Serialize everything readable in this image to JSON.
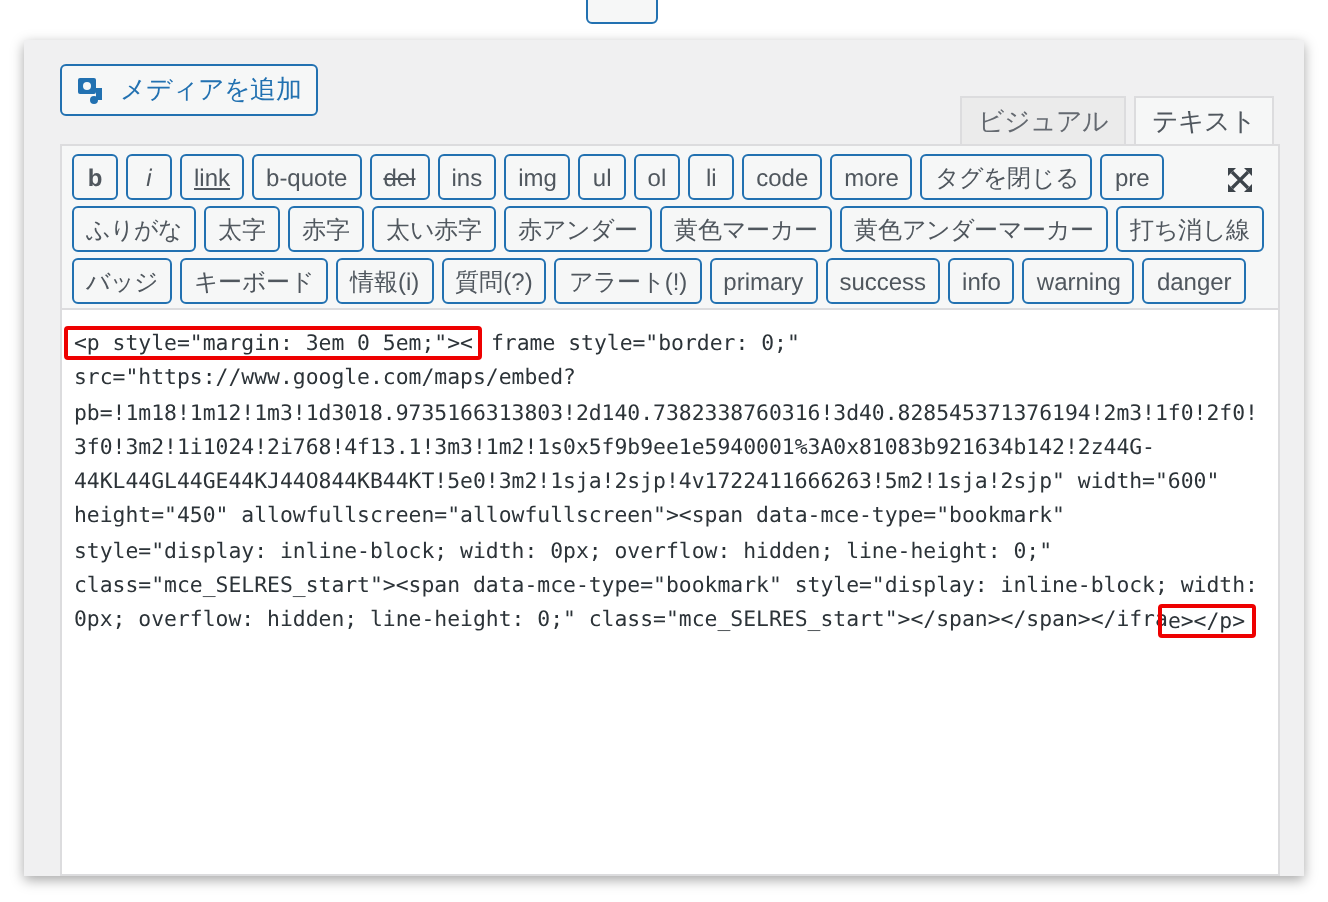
{
  "media_button": {
    "label": "メディアを追加"
  },
  "tabs": [
    {
      "label": "ビジュアル",
      "selected": false
    },
    {
      "label": "テキスト",
      "selected": true
    }
  ],
  "toolbar_rows": [
    [
      {
        "label": "b",
        "kind": "bold"
      },
      {
        "label": "i",
        "kind": "italic"
      },
      {
        "label": "link",
        "kind": "underline"
      },
      {
        "label": "b-quote",
        "kind": "plain"
      },
      {
        "label": "del",
        "kind": "strike"
      },
      {
        "label": "ins",
        "kind": "plain"
      },
      {
        "label": "img",
        "kind": "plain"
      },
      {
        "label": "ul",
        "kind": "plain"
      },
      {
        "label": "ol",
        "kind": "plain"
      },
      {
        "label": "li",
        "kind": "plain"
      },
      {
        "label": "code",
        "kind": "plain"
      },
      {
        "label": "more",
        "kind": "plain"
      },
      {
        "label": "タグを閉じる",
        "kind": "plain"
      },
      {
        "label": "pre",
        "kind": "plain"
      }
    ],
    [
      {
        "label": "ふりがな",
        "kind": "plain"
      },
      {
        "label": "太字",
        "kind": "plain"
      },
      {
        "label": "赤字",
        "kind": "plain"
      },
      {
        "label": "太い赤字",
        "kind": "plain"
      },
      {
        "label": "赤アンダー",
        "kind": "plain"
      },
      {
        "label": "黄色マーカー",
        "kind": "plain"
      },
      {
        "label": "黄色アンダーマーカー",
        "kind": "plain"
      },
      {
        "label": "打ち消し線",
        "kind": "plain"
      }
    ],
    [
      {
        "label": "バッジ",
        "kind": "plain"
      },
      {
        "label": "キーボード",
        "kind": "plain"
      },
      {
        "label": "情報(i)",
        "kind": "plain"
      },
      {
        "label": "質問(?)",
        "kind": "plain"
      },
      {
        "label": "アラート(!)",
        "kind": "plain"
      },
      {
        "label": "primary",
        "kind": "plain"
      },
      {
        "label": "success",
        "kind": "plain"
      },
      {
        "label": "info",
        "kind": "plain"
      },
      {
        "label": "warning",
        "kind": "plain"
      },
      {
        "label": "danger",
        "kind": "plain"
      }
    ]
  ],
  "code_lines": [
    {
      "segments": [
        {
          "text": "<p style=\"margin: 3em 0 5em;\"><",
          "highlighted": true
        },
        {
          "text": "frame style=\"border: 0;\"",
          "highlighted": false
        }
      ]
    },
    {
      "segments": [
        {
          "text": "src=\"https://www.google.com/maps/embed?",
          "highlighted": false
        }
      ]
    },
    {
      "segments": [
        {
          "text": "pb=!1m18!1m12!1m3!1d3018.9735166313803!2d140.7382338760316!3d40.828545371376194!2m3!1f0!2f0!",
          "highlighted": false
        }
      ]
    },
    {
      "segments": [
        {
          "text": "3f0!3m2!1i1024!2i768!4f13.1!3m3!1m2!1s0x5f9b9ee1e5940001%3A0x81083b921634b142!2z44G-",
          "highlighted": false
        }
      ]
    },
    {
      "segments": [
        {
          "text": "44KL44GL44GE44KJ44O844KB44KT!5e0!3m2!1sja!2sjp!4v1722411666263!5m2!1sja!2sjp\" width=\"600\"",
          "highlighted": false
        }
      ]
    },
    {
      "segments": [
        {
          "text": "height=\"450\" allowfullscreen=\"allowfullscreen\"><span data-mce-type=\"bookmark\"",
          "highlighted": false
        }
      ]
    },
    {
      "segments": [
        {
          "text": "style=\"display: inline-block; width: 0px; overflow: hidden; line-height: 0;\"",
          "highlighted": false
        }
      ]
    },
    {
      "segments": [
        {
          "text": "class=\"mce_SELRES_start\"><span data-mce-type=\"bookmark\" style=\"display: inline-block; width:",
          "highlighted": false
        }
      ]
    },
    {
      "segments": [
        {
          "text": "0px; overflow: hidden; line-height: 0;\" class=\"mce_SELRES_start\"></span></span></ifra",
          "highlighted": false
        },
        {
          "text": "e></p>",
          "highlighted": true
        }
      ]
    }
  ]
}
